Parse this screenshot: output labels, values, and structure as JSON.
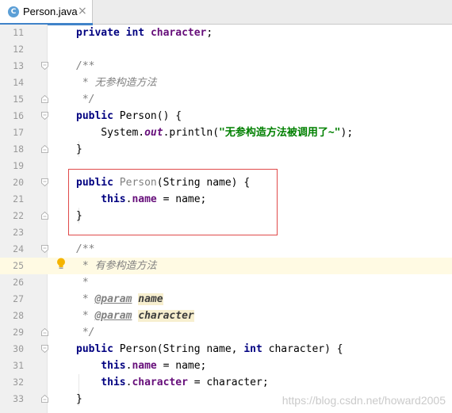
{
  "tab": {
    "icon_letter": "C",
    "title": "Person.java",
    "close": "×"
  },
  "colors": {
    "keyword": "#000080",
    "field": "#660e7a",
    "string": "#008000",
    "comment": "#808080",
    "highlight_border": "#e04a4a",
    "caret_line": "#fffae3"
  },
  "icons": {
    "tab": "java-class-icon",
    "bulb": "lightbulb-icon",
    "fold": "fold-marker-icon"
  },
  "lines": [
    {
      "n": "11",
      "t": [
        [
          "kw",
          "private"
        ],
        [
          "",
          ""
        ],
        [
          "kw",
          "int"
        ],
        [
          "",
          ""
        ],
        [
          "field",
          "character"
        ],
        [
          "",
          ";"
        ]
      ]
    },
    {
      "n": "12",
      "t": []
    },
    {
      "n": "13",
      "t": [
        [
          "cmt",
          "/**"
        ]
      ]
    },
    {
      "n": "14",
      "t": [
        [
          "cmt",
          " * 无参构造方法"
        ]
      ]
    },
    {
      "n": "15",
      "t": [
        [
          "cmt",
          " */"
        ]
      ]
    },
    {
      "n": "16",
      "t": [
        [
          "kw",
          "public"
        ],
        [
          "",
          " Person() {"
        ]
      ]
    },
    {
      "n": "17",
      "t": [
        [
          "",
          "    System."
        ],
        [
          "static",
          "out"
        ],
        [
          "",
          ".println("
        ],
        [
          "str",
          "\"无参构造方法被调用了~\""
        ],
        [
          "",
          ");"
        ]
      ]
    },
    {
      "n": "18",
      "t": [
        [
          "",
          "}"
        ]
      ]
    },
    {
      "n": "19",
      "t": []
    },
    {
      "n": "20",
      "t": [
        [
          "kw",
          "public"
        ],
        [
          "",
          ""
        ],
        [
          "unused",
          "Person"
        ],
        [
          "",
          "(String name) {"
        ]
      ]
    },
    {
      "n": "21",
      "t": [
        [
          "kw",
          "    this"
        ],
        [
          "",
          "."
        ],
        [
          "field",
          "name"
        ],
        [
          "",
          " = name;"
        ]
      ]
    },
    {
      "n": "22",
      "t": [
        [
          "",
          "}"
        ]
      ]
    },
    {
      "n": "23",
      "t": []
    },
    {
      "n": "24",
      "t": [
        [
          "cmt",
          "/**"
        ]
      ]
    },
    {
      "n": "25",
      "t": [
        [
          "cmt",
          " * 有参构造方法"
        ]
      ]
    },
    {
      "n": "26",
      "t": [
        [
          "cmt",
          " *"
        ]
      ]
    },
    {
      "n": "27",
      "t": [
        [
          "cmt",
          " * "
        ],
        [
          "tag",
          "@param"
        ],
        [
          "cmt",
          ""
        ],
        [
          "param",
          "name"
        ]
      ]
    },
    {
      "n": "28",
      "t": [
        [
          "cmt",
          " * "
        ],
        [
          "tag",
          "@param"
        ],
        [
          "cmt",
          ""
        ],
        [
          "param",
          "character"
        ]
      ]
    },
    {
      "n": "29",
      "t": [
        [
          "cmt",
          " */"
        ]
      ]
    },
    {
      "n": "30",
      "t": [
        [
          "kw",
          "public"
        ],
        [
          "",
          " Person(String name, "
        ],
        [
          "kw",
          "int"
        ],
        [
          "",
          " character) {"
        ]
      ]
    },
    {
      "n": "31",
      "t": [
        [
          "kw",
          "    this"
        ],
        [
          "",
          "."
        ],
        [
          "field",
          "name"
        ],
        [
          "",
          " = name;"
        ]
      ]
    },
    {
      "n": "32",
      "t": [
        [
          "kw",
          "    this"
        ],
        [
          "",
          "."
        ],
        [
          "field",
          "character"
        ],
        [
          "",
          " = character;"
        ]
      ]
    },
    {
      "n": "33",
      "t": [
        [
          "",
          "}"
        ]
      ]
    }
  ],
  "caret_line": "25",
  "watermark": "https://blog.csdn.net/howard2005"
}
